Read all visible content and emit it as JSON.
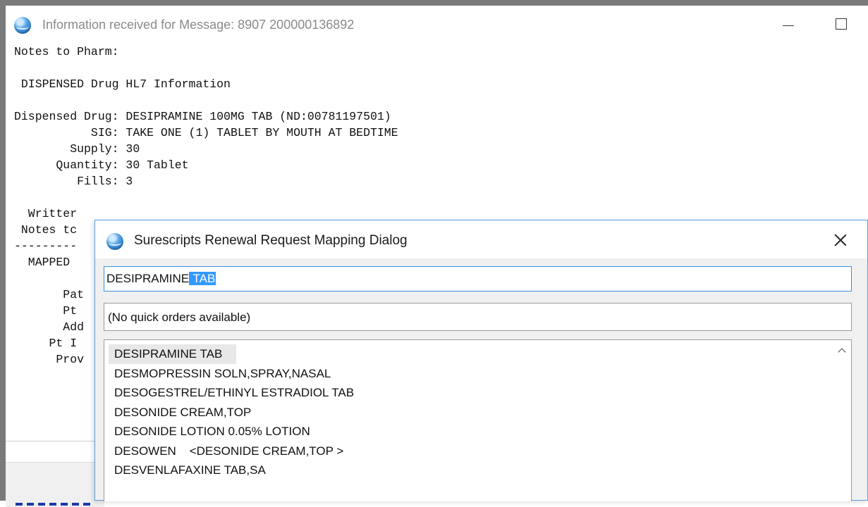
{
  "background_window": {
    "title": "Information received for Message: 8907 200000136892",
    "lines": [
      "Notes to Pharm:",
      "",
      " DISPENSED Drug HL7 Information",
      "",
      "Dispensed Drug: DESIPRAMINE 100MG TAB (ND:00781197501)",
      "           SIG: TAKE ONE (1) TABLET BY MOUTH AT BEDTIME",
      "        Supply: 30",
      "      Quantity: 30 Tablet",
      "         Fills: 3",
      "",
      "  Writter",
      " Notes tc",
      "---------",
      "  MAPPED",
      "",
      "       Pat",
      "       Pt",
      "       Add",
      "     Pt I",
      "      Prov"
    ]
  },
  "dialog": {
    "title": "Surescripts Renewal Request Mapping Dialog",
    "search": {
      "value_prefix": "DESIPRAMINE",
      "value_selected": " TAB"
    },
    "quick_orders_text": "(No quick orders available)",
    "drug_list": [
      "DESIPRAMINE TAB",
      "DESMOPRESSIN SOLN,SPRAY,NASAL",
      "DESOGESTREL/ETHINYL ESTRADIOL TAB",
      "DESONIDE CREAM,TOP",
      "DESONIDE LOTION 0.05% LOTION",
      "DESOWEN    <DESONIDE CREAM,TOP >",
      "DESVENLAFAXINE TAB,SA"
    ],
    "selected_index": 0
  },
  "colors": {
    "selection_highlight": "#3399ff",
    "focus_border": "#3c8ee0",
    "dialog_background": "#f0f0f0"
  },
  "icons": {
    "window_icon": "app-globe-icon",
    "close": "close-icon",
    "minimize": "minimize-icon",
    "maximize": "maximize-icon",
    "scroll_up": "chevron-up-icon"
  }
}
